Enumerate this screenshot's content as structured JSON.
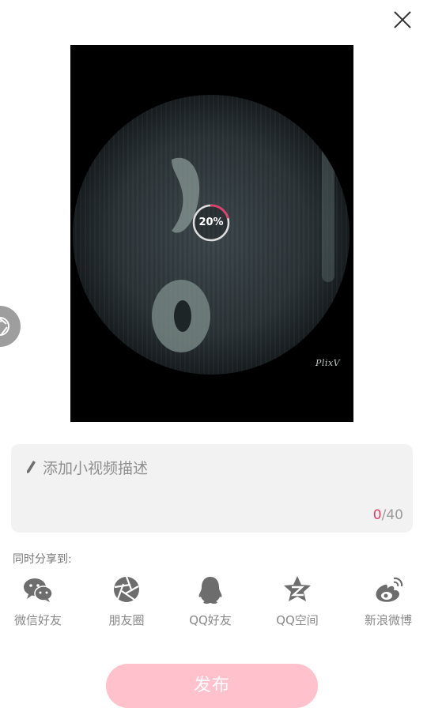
{
  "video": {
    "progress_text": "20%",
    "progress_fraction": 0.2,
    "watermark": "PlixV",
    "accent_color": "#e8386a"
  },
  "description": {
    "placeholder": "添加小视频描述",
    "count_current": "0",
    "count_separator": "/",
    "count_max": "40"
  },
  "share": {
    "title": "同时分享到:",
    "items": [
      {
        "label": "微信好友",
        "icon": "wechat-icon"
      },
      {
        "label": "朋友圈",
        "icon": "moments-icon"
      },
      {
        "label": "QQ好友",
        "icon": "qq-icon"
      },
      {
        "label": "QQ空间",
        "icon": "qzone-icon"
      },
      {
        "label": "新浪微博",
        "icon": "weibo-icon"
      }
    ]
  },
  "publish_button": {
    "label": "发布",
    "color": "#ffc1cc"
  },
  "icons": {
    "close": "close-icon",
    "floating": "camera-aperture-icon",
    "pencil": "pencil-icon"
  }
}
